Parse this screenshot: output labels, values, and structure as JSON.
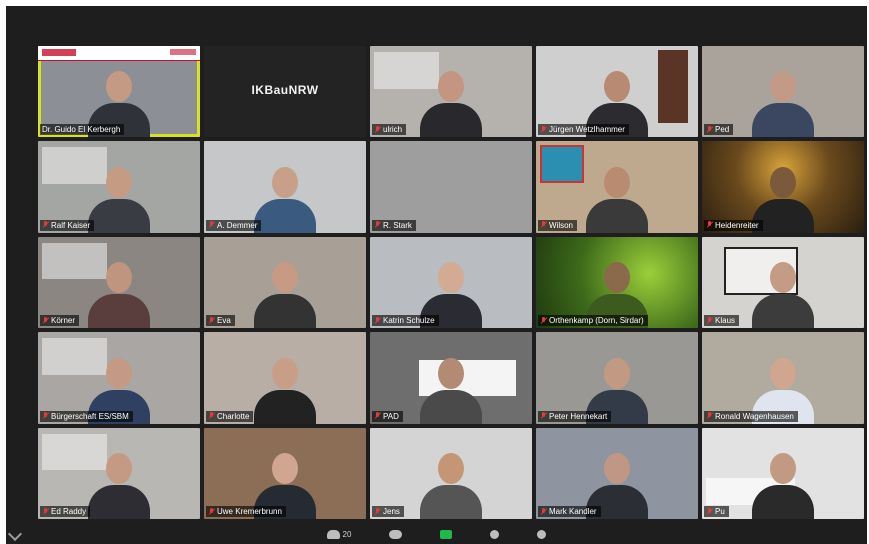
{
  "meeting": {
    "blank_tile_title": "IKBauNRW"
  },
  "tiles": [
    {
      "name": "Dr. Guido El Kerbergh",
      "bg": "#8c8f95",
      "skin": "#c59a84",
      "shirt": "#30323a",
      "type": "presenter",
      "muted": false
    },
    {
      "name": "",
      "type": "blank",
      "muted": true
    },
    {
      "name": "ulrich",
      "bg": "#b5b2ad",
      "skin": "#c49580",
      "shirt": "#28282d",
      "type": "shelf",
      "muted": true
    },
    {
      "name": "Jürgen Wetzlhammer",
      "bg": "#cfcfcf",
      "skin": "#b88a74",
      "shirt": "#2c2c30",
      "type": "door",
      "muted": true
    },
    {
      "name": "Ped",
      "bg": "#a9a39c",
      "skin": "#c29a86",
      "shirt": "#3b4660",
      "type": "plain",
      "muted": true
    },
    {
      "name": "Ralf Kaiser",
      "bg": "#a4a6a3",
      "skin": "#c59b84",
      "shirt": "#3a3c44",
      "type": "shelf",
      "muted": true
    },
    {
      "name": "A. Demmer",
      "bg": "#c5c7c9",
      "skin": "#c8a08a",
      "shirt": "#3b5a80",
      "type": "plain",
      "muted": true
    },
    {
      "name": "R. Stark",
      "bg": "#9e9e9e",
      "skin": "#b58c78",
      "shirt": "#555555",
      "type": "empty",
      "muted": true
    },
    {
      "name": "Wilson",
      "bg": "#bfa98e",
      "skin": "#b98b70",
      "shirt": "#3a3a3a",
      "type": "art",
      "muted": true
    },
    {
      "name": "Heidenreiter",
      "bg": "#4b3a22",
      "skin": "#7a5a3a",
      "shirt": "#222222",
      "type": "night",
      "muted": true
    },
    {
      "name": "Körner",
      "bg": "#8b8682",
      "skin": "#c09580",
      "shirt": "#5a3d3d",
      "type": "room",
      "muted": true
    },
    {
      "name": "Eva",
      "bg": "#a8a097",
      "skin": "#c69a84",
      "shirt": "#333333",
      "type": "plain",
      "muted": true
    },
    {
      "name": "Katrin Schulze",
      "bg": "#b9bcc0",
      "skin": "#d2ab92",
      "shirt": "#2b2b33",
      "type": "plain",
      "muted": true
    },
    {
      "name": "Orthenkamp (Dorn, Sirdar)",
      "bg": "#4f6a2a",
      "skin": "#8a6a4a",
      "shirt": "#3d5a1f",
      "type": "plants",
      "muted": true
    },
    {
      "name": "Klaus",
      "bg": "#d5d3d0",
      "skin": "#c49c86",
      "shirt": "#3c3c3c",
      "type": "map",
      "muted": true
    },
    {
      "name": "Bürgerschaft ES/SBM",
      "bg": "#a9a6a3",
      "skin": "#c49a84",
      "shirt": "#2f4063",
      "type": "room",
      "muted": true
    },
    {
      "name": "Charlotte",
      "bg": "#b8aea6",
      "skin": "#c99e88",
      "shirt": "#222222",
      "type": "plain",
      "muted": true
    },
    {
      "name": "PAD",
      "bg": "#6e6e6e",
      "skin": "#b38a74",
      "shirt": "#4a4a4a",
      "type": "table",
      "muted": true
    },
    {
      "name": "Peter Hennekart",
      "bg": "#9a9895",
      "skin": "#c29a84",
      "shirt": "#333a48",
      "type": "wall",
      "muted": true
    },
    {
      "name": "Ronald Wagenhausen",
      "bg": "#b1aa9f",
      "skin": "#d0a690",
      "shirt": "#dfe4ee",
      "type": "plain",
      "muted": true
    },
    {
      "name": "Ed Raddy",
      "bg": "#b9b7b4",
      "skin": "#c59a84",
      "shirt": "#2d2d33",
      "type": "room",
      "muted": true
    },
    {
      "name": "Uwe Kremerbrunn",
      "bg": "#8c6d55",
      "skin": "#d1a690",
      "shirt": "#262a33",
      "type": "plain",
      "muted": true
    },
    {
      "name": "Jens",
      "bg": "#d4d4d4",
      "skin": "#c59676",
      "shirt": "#555555",
      "type": "plain",
      "muted": true
    },
    {
      "name": "Mark Kandler",
      "bg": "#8f95a0",
      "skin": "#c09684",
      "shirt": "#2c2e36",
      "type": "plain",
      "muted": true
    },
    {
      "name": "Pu",
      "bg": "#e2e2e2",
      "skin": "#c29a84",
      "shirt": "#2a2a2a",
      "type": "kitchen",
      "muted": true
    }
  ],
  "toolbar": {
    "participants_count": "20",
    "items": [
      {
        "icon": "participants-icon"
      },
      {
        "icon": "chat-icon"
      },
      {
        "icon": "share-screen-icon"
      },
      {
        "icon": "record-icon"
      },
      {
        "icon": "reactions-icon"
      }
    ]
  }
}
